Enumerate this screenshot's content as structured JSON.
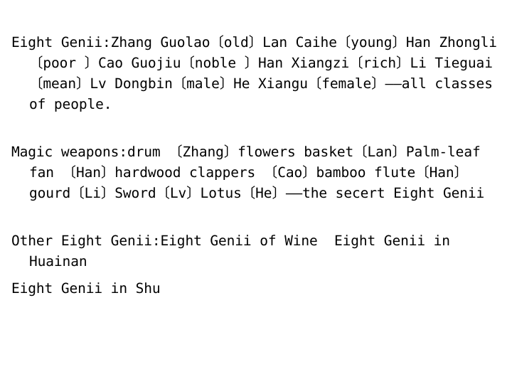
{
  "document": {
    "background_color": "#ffffff",
    "text_color": "#000000",
    "paragraphs": [
      {
        "id": "eight-genii",
        "text": "Eight Genii:Zhang Guolao〔old〕Lan Caihe〔young〕Han Zhongli〔poor 〕Cao Guojiu〔noble 〕Han Xiangzi〔rich〕Li Tieguai〔mean〕Lv Dongbin〔male〕He Xiangu〔female〕——all classes of people."
      },
      {
        "id": "magic-weapons",
        "text": "Magic weapons:drum 〔Zhang〕flowers basket〔Lan〕Palm-leaf fan 〔Han〕hardwood clappers 〔Cao〕bamboo flute〔Han〕gourd〔Li〕Sword〔Lv〕Lotus〔He〕——the secert Eight Genii"
      },
      {
        "id": "other-eight-genii",
        "text": "Other Eight Genii:Eight Genii of Wine  Eight Genii in Huainan"
      },
      {
        "id": "eight-genii-in-shu",
        "text": "Eight Genii in Shu"
      }
    ]
  }
}
